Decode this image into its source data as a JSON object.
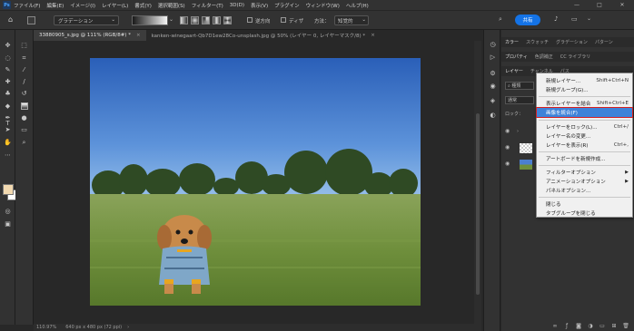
{
  "app": {
    "logo": "Ps"
  },
  "menubar": {
    "items": [
      "ファイル(F)",
      "編集(E)",
      "イメージ(I)",
      "レイヤー(L)",
      "書式(Y)",
      "選択範囲(S)",
      "フィルター(T)",
      "3D(D)",
      "表示(V)",
      "プラグイン",
      "ウィンドウ(W)",
      "ヘルプ(H)"
    ],
    "window_controls": [
      "—",
      "□",
      "✕"
    ]
  },
  "options": {
    "gradient_mode": "グラデーション",
    "reverse_label": "逆方向",
    "dither_label": "ディザ",
    "method_label": "方法：",
    "method_value": "知覚的",
    "share_label": "共有"
  },
  "tabs": [
    {
      "label": "33880905_s.jpg @ 111% (RGB/8#) *",
      "close": "×"
    },
    {
      "label": "kanken-winegaart-Qb7D1ew28Co-unsplash.jpg @ 50% (レイヤー 0, レイヤーマスク/8) *",
      "close": "×"
    }
  ],
  "statusbar": {
    "zoom": "110.97%",
    "dims": "640 px x 480 px (72 ppi)",
    "arrow": "›"
  },
  "panels": {
    "top_tabs": [
      "カラー",
      "スウォッチ",
      "グラデーション",
      "パターン"
    ],
    "second_tabs": [
      "プロパティ",
      "色調補正",
      "CC ライブラリ"
    ],
    "layers_tabs": [
      "レイヤー",
      "チャンネル",
      "パス"
    ],
    "search_kind": "種類",
    "blend_mode": "通常",
    "lock_label": "ロック："
  },
  "context_menu": {
    "items": [
      {
        "label": "新規レイヤー...",
        "shortcut": "Shift+Ctrl+N"
      },
      {
        "label": "新規グループ(G)...",
        "shortcut": ""
      },
      {
        "label": "表示レイヤーを結合",
        "shortcut": "Shift+Ctrl+E"
      },
      {
        "label": "画像を統合(F)",
        "shortcut": "",
        "highlighted": true
      },
      {
        "label": "レイヤーをロック(L)...",
        "shortcut": "Ctrl+/"
      },
      {
        "label": "レイヤー名の変更...",
        "shortcut": ""
      },
      {
        "label": "レイヤーを表示(R)",
        "shortcut": "Ctrl+,"
      },
      {
        "label": "アートボードを新規作成...",
        "shortcut": ""
      },
      {
        "label": "フィルターオプション",
        "shortcut": "",
        "submenu": true
      },
      {
        "label": "アニメーションオプション",
        "shortcut": "",
        "submenu": true
      },
      {
        "label": "パネルオプション...",
        "shortcut": ""
      },
      {
        "label": "閉じる",
        "shortcut": ""
      },
      {
        "label": "タブグループを閉じる",
        "shortcut": ""
      }
    ]
  },
  "colors": {
    "accent": "#1473e6",
    "highlight": "#3e82d8",
    "highlight_border": "#d62020",
    "foreground_swatch": "#f2d9b0",
    "background_swatch": "#ffffff"
  }
}
